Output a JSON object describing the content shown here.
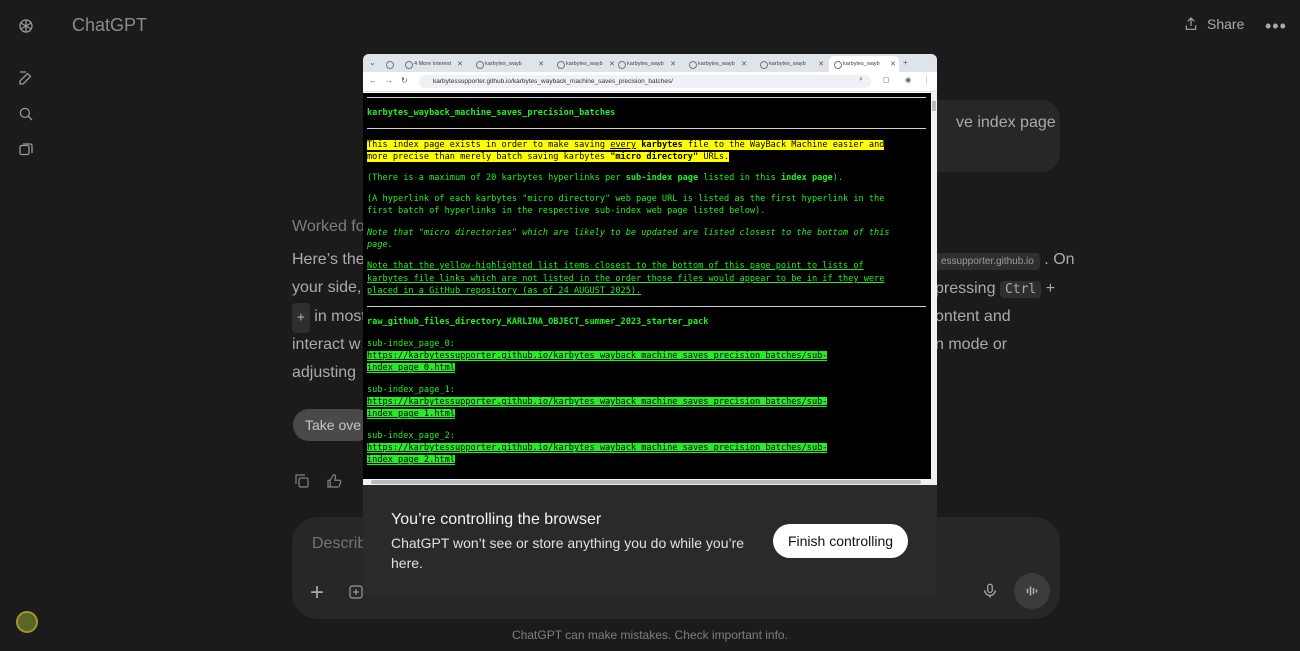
{
  "app": {
    "title": "ChatGPT",
    "share_label": "Share",
    "more_label": "•••"
  },
  "chat": {
    "user_message_fragment": "ve index page",
    "worked_label": "Worked fo",
    "reply_lines": [
      "Here’s the",
      "your side,",
      "in most",
      "interact w",
      "adjusting"
    ],
    "reply_right_fragments": {
      "line1_chip": "essupporter.github.io",
      "line1_end": ". On",
      "line2_text": "pressing",
      "line2_kbd": "Ctrl",
      "line2_plus": "+",
      "line3_kbd": "+",
      "line3_text": "ontent and",
      "line4_text": "n mode or"
    },
    "take_over_label": "Take ove"
  },
  "composer": {
    "placeholder": "Describ",
    "disclaimer": "ChatGPT can make mistakes. Check important info."
  },
  "browser": {
    "tabs": [
      {
        "label": "",
        "active": false
      },
      {
        "label": "4 More Interest",
        "active": false
      },
      {
        "label": "karbytes_wayb",
        "active": false
      },
      {
        "label": "karbytes_wayb",
        "active": false
      },
      {
        "label": "karbytes_wayb",
        "active": false
      },
      {
        "label": "karbytes_wayb",
        "active": false
      },
      {
        "label": "karbytes_wayb",
        "active": false
      },
      {
        "label": "karbytes_wayb",
        "active": true
      }
    ],
    "new_tab_label": "+",
    "url": "karbytessupporter.github.io/karbytes_wayback_machine_saves_precision_batches/"
  },
  "page": {
    "heading": "karbytes_wayback_machine_saves_precision_batches",
    "intro_line1_a": "This index page exists in order to make saving ",
    "intro_line1_every": "every",
    "intro_line1_b": " ",
    "intro_line1_karbytes": "karbytes",
    "intro_line1_c": " file to the WayBack Machine easier and",
    "intro_line2_a": "more precise than merely batch saving karbytes ",
    "intro_line2_micro": "\"micro directory\"",
    "intro_line2_b": " URLs.",
    "max_a": "(There is a maximum of 20 karbytes hyperlinks per ",
    "max_sub": "sub-index page",
    "max_b": " listed in this ",
    "max_index": "index page",
    "max_c": ").",
    "hyper_line1": "(A hyperlink of each karbytes \"micro directory\" web page URL is listed as the first hyperlink in the",
    "hyper_line2": "first batch of hyperlinks in the respective sub-index web page listed below).",
    "note1_line1": "Note that \"micro directories\" which are likely to be updated are listed closest to the bottom of this",
    "note1_line2": "page.",
    "note2_line1": "Note that the yellow-highlighted list items closest to the bottom of this page point to lists of",
    "note2_line2": "karbytes file links which are not listed in the order those files would appear to be in if they were",
    "note2_line3": "placed in a GitHub repository (as of 24 AUGUST 2025).",
    "section_heading": "raw_github_files_directory_KARLINA_OBJECT_summer_2023_starter_pack",
    "subpages": [
      {
        "label": "sub-index_page_0:",
        "link1": "https://karbytessupporter.github.io/karbytes_wayback_machine_saves_precision_batches/sub-",
        "link2": "index_page_0.html"
      },
      {
        "label": "sub-index_page_1:",
        "link1": "https://karbytessupporter.github.io/karbytes_wayback_machine_saves_precision_batches/sub-",
        "link2": "index_page_1.html"
      },
      {
        "label": "sub-index_page_2:",
        "link1": "https://karbytessupporter.github.io/karbytes_wayback_machine_saves_precision_batches/sub-",
        "link2": "index_page_2.html"
      }
    ]
  },
  "control": {
    "heading": "You’re controlling the browser",
    "body": "ChatGPT won’t see or store anything you do while you’re here.",
    "finish_label": "Finish controlling"
  }
}
